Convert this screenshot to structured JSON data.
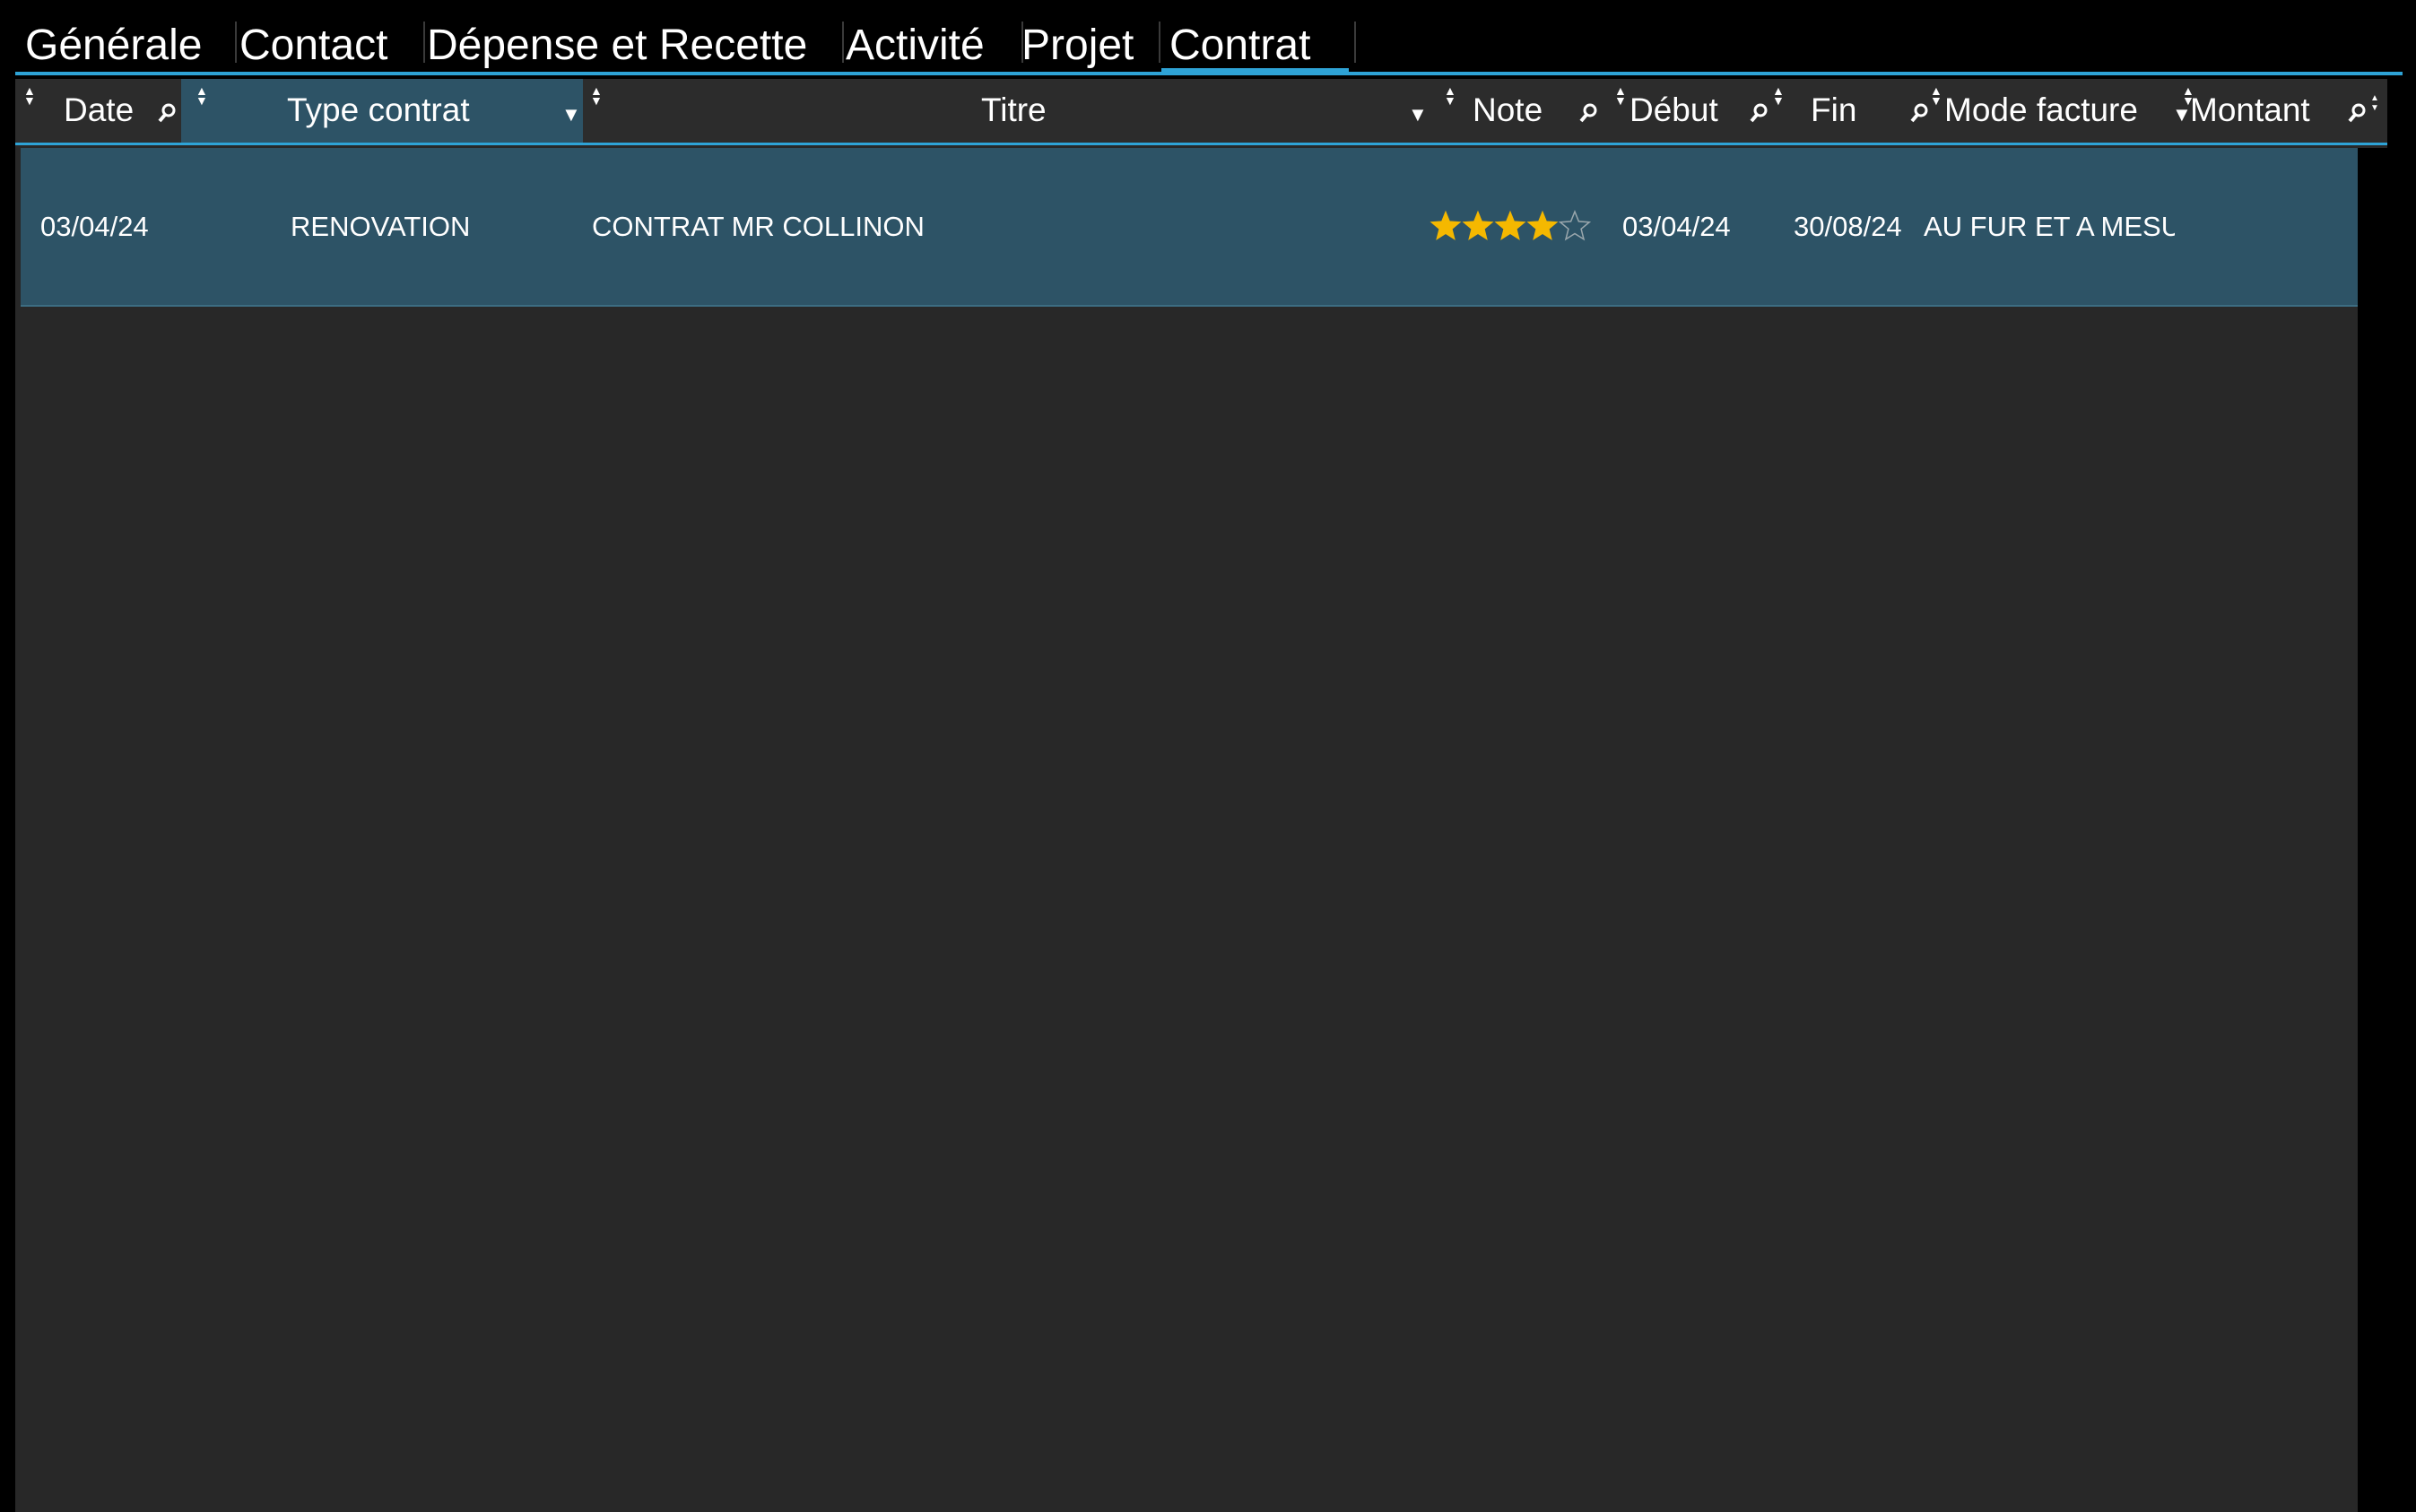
{
  "tabs": [
    {
      "label": "Générale"
    },
    {
      "label": "Contact"
    },
    {
      "label": "Dépense et Recette"
    },
    {
      "label": "Activité"
    },
    {
      "label": "Projet"
    },
    {
      "label": "Contrat",
      "active": true
    }
  ],
  "columns": [
    {
      "label": "Date",
      "tool": "search"
    },
    {
      "label": "Type contrat",
      "tool": "filter",
      "highlighted": true
    },
    {
      "label": "Titre",
      "tool": "filter"
    },
    {
      "label": "Note",
      "tool": "search"
    },
    {
      "label": "Début",
      "tool": "search"
    },
    {
      "label": "Fin",
      "tool": "search"
    },
    {
      "label": "Mode facture",
      "tool": "filter"
    },
    {
      "label": "Montant",
      "tool": "search"
    }
  ],
  "rows": [
    {
      "date": "03/04/24",
      "type_contrat": "RENOVATION",
      "titre": "CONTRAT MR COLLINON",
      "note": 4,
      "note_max": 5,
      "debut": "03/04/24",
      "fin": "30/08/24",
      "mode_facture": "AU FUR ET A MESURE",
      "montant": ""
    }
  ],
  "colors": {
    "accent": "#2ea3d6",
    "row_selected": "#2d5366",
    "grid_bg": "#282828",
    "star": "#f5b800"
  }
}
